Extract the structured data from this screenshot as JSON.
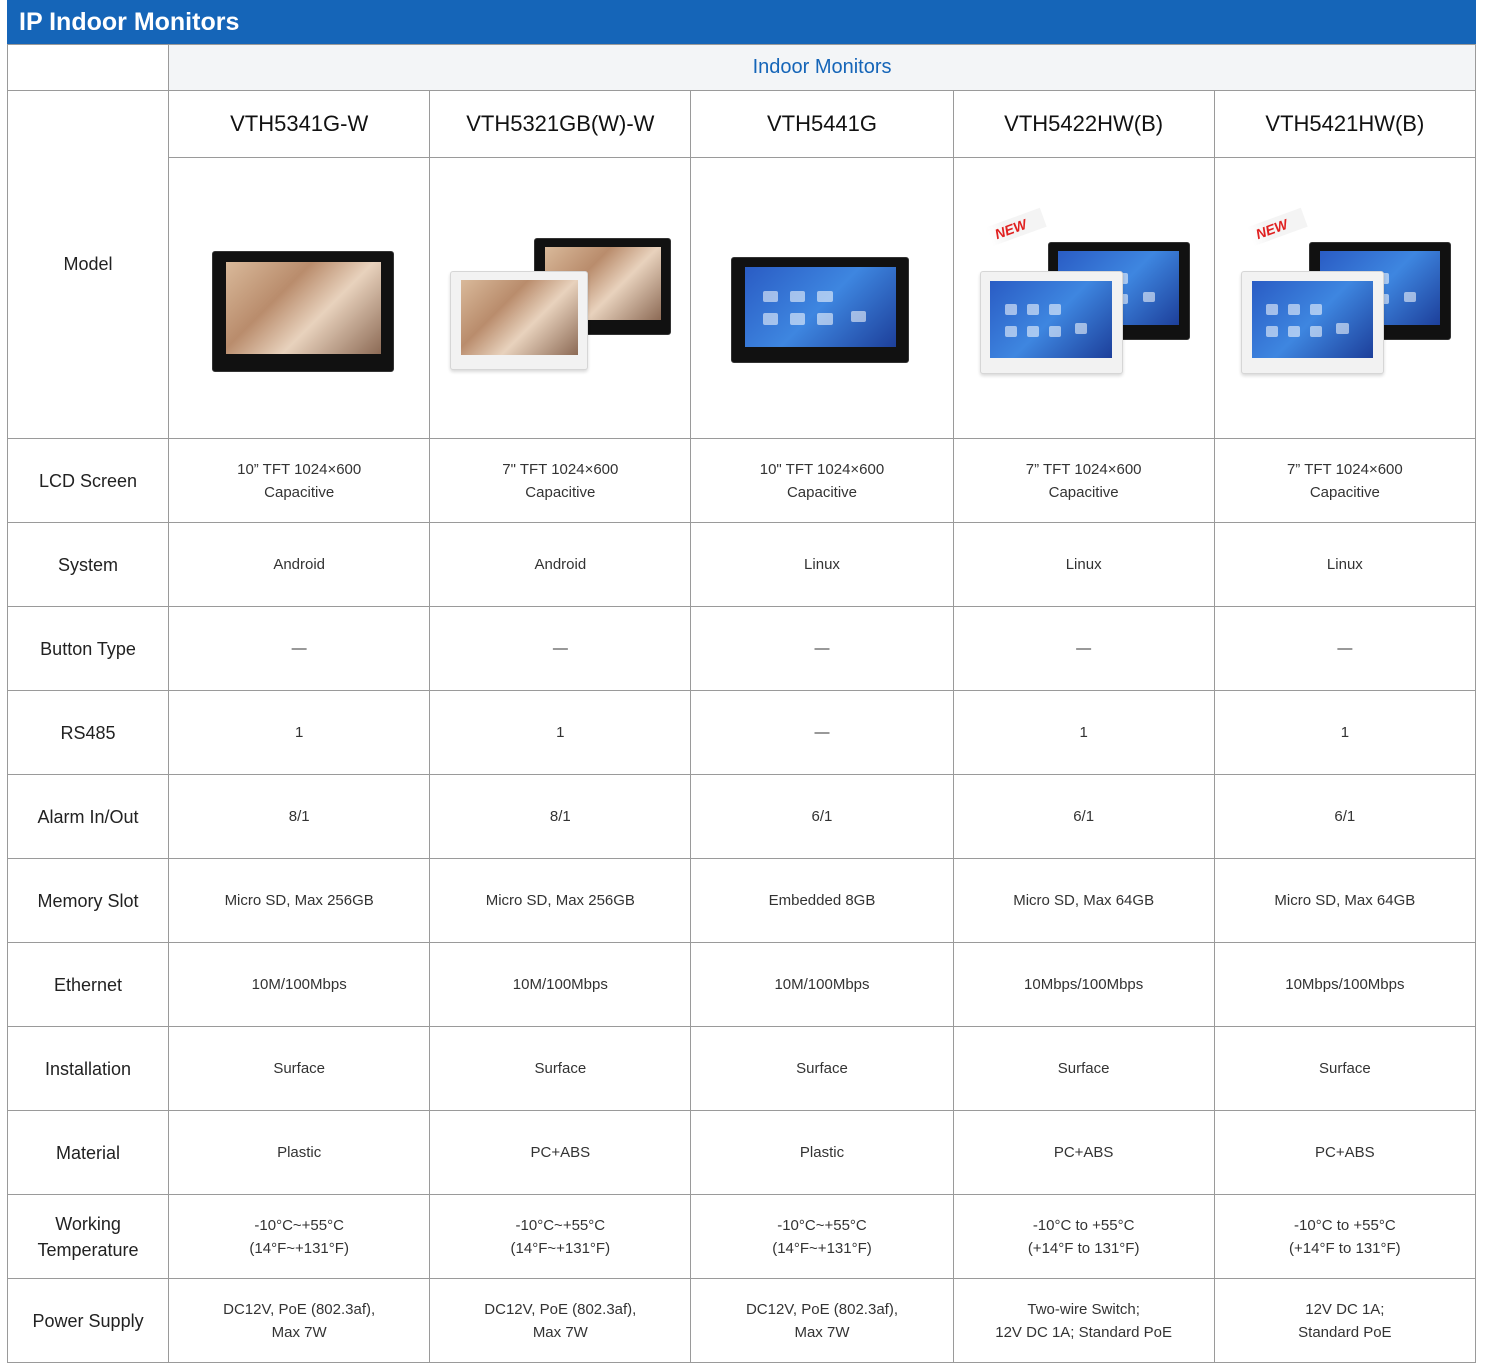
{
  "title": "IP Indoor Monitors",
  "group_header": "Indoor Monitors",
  "model_label": "Model",
  "models": [
    {
      "name": "VTH5341G-W",
      "style": "single-black-photo",
      "is_new": false
    },
    {
      "name": "VTH5321GB(W)-W",
      "style": "pair-photo",
      "is_new": false
    },
    {
      "name": "VTH5441G",
      "style": "single-black-ui",
      "is_new": false
    },
    {
      "name": "VTH5422HW(B)",
      "style": "pair-ui",
      "is_new": true
    },
    {
      "name": "VTH5421HW(B)",
      "style": "pair-ui",
      "is_new": true
    }
  ],
  "new_badge": "NEW",
  "rows": [
    {
      "label": "LCD Screen",
      "values": [
        "10” TFT 1024×600\nCapacitive",
        "7\" TFT 1024×600\nCapacitive",
        "10\" TFT 1024×600\nCapacitive",
        "7” TFT 1024×600\nCapacitive",
        "7” TFT 1024×600\nCapacitive"
      ]
    },
    {
      "label": "System",
      "values": [
        "Android",
        "Android",
        "Linux",
        "Linux",
        "Linux"
      ]
    },
    {
      "label": "Button Type",
      "values": [
        "—",
        "—",
        "—",
        "—",
        "—"
      ]
    },
    {
      "label": "RS485",
      "values": [
        "1",
        "1",
        "—",
        "1",
        "1"
      ]
    },
    {
      "label": "Alarm In/Out",
      "values": [
        "8/1",
        "8/1",
        "6/1",
        "6/1",
        "6/1"
      ]
    },
    {
      "label": "Memory Slot",
      "values": [
        "Micro SD, Max 256GB",
        "Micro SD, Max 256GB",
        "Embedded 8GB",
        "Micro SD, Max 64GB",
        "Micro SD, Max 64GB"
      ]
    },
    {
      "label": "Ethernet",
      "values": [
        "10M/100Mbps",
        "10M/100Mbps",
        "10M/100Mbps",
        "10Mbps/100Mbps",
        "10Mbps/100Mbps"
      ]
    },
    {
      "label": "Installation",
      "values": [
        "Surface",
        "Surface",
        "Surface",
        "Surface",
        "Surface"
      ]
    },
    {
      "label": "Material",
      "values": [
        "Plastic",
        "PC+ABS",
        "Plastic",
        "PC+ABS",
        "PC+ABS"
      ]
    },
    {
      "label": "Working\nTemperature",
      "values": [
        "-10°C~+55°C\n(14°F~+131°F)",
        "-10°C~+55°C\n(14°F~+131°F)",
        "-10°C~+55°C\n(14°F~+131°F)",
        "-10°C to +55°C\n(+14°F to 131°F)",
        "-10°C to +55°C\n(+14°F to 131°F)"
      ]
    },
    {
      "label": "Power Supply",
      "values": [
        "DC12V, PoE (802.3af),\nMax 7W",
        "DC12V, PoE (802.3af),\nMax 7W",
        "DC12V, PoE (802.3af),\nMax 7W",
        "Two-wire Switch;\n12V DC 1A; Standard PoE",
        "12V DC 1A;\nStandard PoE"
      ]
    }
  ]
}
